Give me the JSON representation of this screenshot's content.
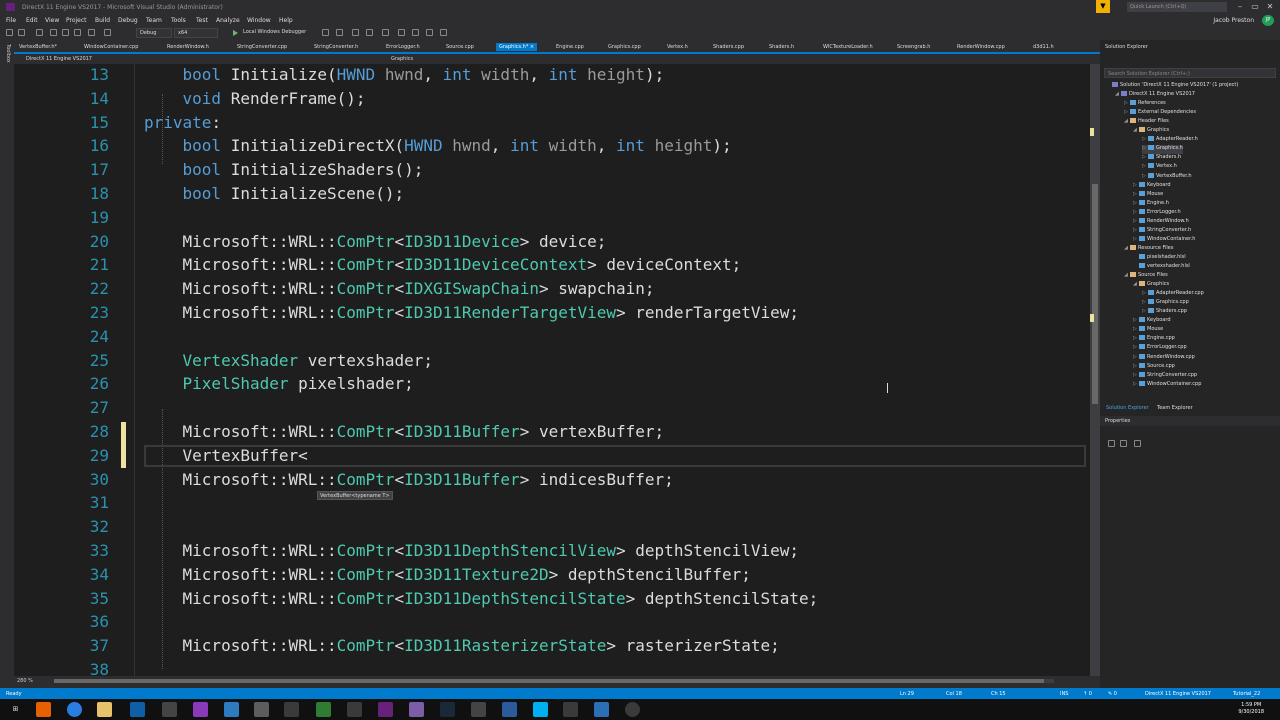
{
  "window": {
    "title": "DirectX 11 Engine VS2017 - Microsoft Visual Studio (Administrator)",
    "quick_launch": "Quick Launch (Ctrl+Q)",
    "user": "Jacob Preston",
    "user_initials": "JP"
  },
  "menu": [
    "File",
    "Edit",
    "View",
    "Project",
    "Build",
    "Debug",
    "Team",
    "Tools",
    "Test",
    "Analyze",
    "Window",
    "Help"
  ],
  "toolbar": {
    "config": "Debug",
    "platform": "x64",
    "debugger": "Local Windows Debugger"
  },
  "tabs": [
    {
      "label": "VertexBuffer.h*",
      "active": false
    },
    {
      "label": "WindowContainer.cpp",
      "active": false
    },
    {
      "label": "RenderWindow.h",
      "active": false
    },
    {
      "label": "StringConverter.cpp",
      "active": false
    },
    {
      "label": "StringConverter.h",
      "active": false
    },
    {
      "label": "ErrorLogger.h",
      "active": false
    },
    {
      "label": "Source.cpp",
      "active": false
    },
    {
      "label": "Graphics.h*  ×",
      "active": true
    },
    {
      "label": "Engine.cpp",
      "active": false
    },
    {
      "label": "Graphics.cpp",
      "active": false
    },
    {
      "label": "Vertex.h",
      "active": false
    },
    {
      "label": "Shaders.cpp",
      "active": false
    },
    {
      "label": "Shaders.h",
      "active": false
    },
    {
      "label": "WICTextureLoader.h",
      "active": false
    },
    {
      "label": "Screengrab.h",
      "active": false
    },
    {
      "label": "RenderWindow.cpp",
      "active": false
    },
    {
      "label": "d3d11.h",
      "active": false
    }
  ],
  "nav": {
    "project": "DirectX 11 Engine VS2017",
    "scope": "Graphics"
  },
  "left_strip": [
    "Toolbox"
  ],
  "editor": {
    "zoom": "280 %",
    "tooltip": "VertexBuffer<typename T>",
    "lines": [
      {
        "n": "13",
        "parts": [
          {
            "t": "    "
          },
          {
            "t": "bool",
            "c": "kw"
          },
          {
            "t": " Initialize("
          },
          {
            "t": "HWND",
            "c": "kw"
          },
          {
            "t": " hwnd",
            "c": "pm"
          },
          {
            "t": ", "
          },
          {
            "t": "int",
            "c": "kw"
          },
          {
            "t": " width",
            "c": "pm"
          },
          {
            "t": ", "
          },
          {
            "t": "int",
            "c": "kw"
          },
          {
            "t": " height",
            "c": "pm"
          },
          {
            "t": ");"
          }
        ]
      },
      {
        "n": "14",
        "parts": [
          {
            "t": "    "
          },
          {
            "t": "void",
            "c": "kw"
          },
          {
            "t": " RenderFrame();"
          }
        ]
      },
      {
        "n": "15",
        "parts": [
          {
            "t": "private",
            "c": "kw"
          },
          {
            "t": ":"
          }
        ]
      },
      {
        "n": "16",
        "parts": [
          {
            "t": "    "
          },
          {
            "t": "bool",
            "c": "kw"
          },
          {
            "t": " InitializeDirectX("
          },
          {
            "t": "HWND",
            "c": "kw"
          },
          {
            "t": " hwnd",
            "c": "pm"
          },
          {
            "t": ", "
          },
          {
            "t": "int",
            "c": "kw"
          },
          {
            "t": " width",
            "c": "pm"
          },
          {
            "t": ", "
          },
          {
            "t": "int",
            "c": "kw"
          },
          {
            "t": " height",
            "c": "pm"
          },
          {
            "t": ");"
          }
        ]
      },
      {
        "n": "17",
        "parts": [
          {
            "t": "    "
          },
          {
            "t": "bool",
            "c": "kw"
          },
          {
            "t": " InitializeShaders();"
          }
        ]
      },
      {
        "n": "18",
        "parts": [
          {
            "t": "    "
          },
          {
            "t": "bool",
            "c": "kw"
          },
          {
            "t": " InitializeScene();"
          }
        ]
      },
      {
        "n": "19",
        "parts": []
      },
      {
        "n": "20",
        "parts": [
          {
            "t": "    Microsoft::WRL::"
          },
          {
            "t": "ComPtr",
            "c": "ty"
          },
          {
            "t": "<"
          },
          {
            "t": "ID3D11Device",
            "c": "ty"
          },
          {
            "t": "> device;"
          }
        ]
      },
      {
        "n": "21",
        "parts": [
          {
            "t": "    Microsoft::WRL::"
          },
          {
            "t": "ComPtr",
            "c": "ty"
          },
          {
            "t": "<"
          },
          {
            "t": "ID3D11DeviceContext",
            "c": "ty"
          },
          {
            "t": "> deviceContext;"
          }
        ]
      },
      {
        "n": "22",
        "parts": [
          {
            "t": "    Microsoft::WRL::"
          },
          {
            "t": "ComPtr",
            "c": "ty"
          },
          {
            "t": "<"
          },
          {
            "t": "IDXGISwapChain",
            "c": "ty"
          },
          {
            "t": "> swapchain;"
          }
        ]
      },
      {
        "n": "23",
        "parts": [
          {
            "t": "    Microsoft::WRL::"
          },
          {
            "t": "ComPtr",
            "c": "ty"
          },
          {
            "t": "<"
          },
          {
            "t": "ID3D11RenderTargetView",
            "c": "ty"
          },
          {
            "t": "> renderTargetView;"
          }
        ]
      },
      {
        "n": "24",
        "parts": []
      },
      {
        "n": "25",
        "parts": [
          {
            "t": "    "
          },
          {
            "t": "VertexShader",
            "c": "ty"
          },
          {
            "t": " vertexshader;"
          }
        ]
      },
      {
        "n": "26",
        "parts": [
          {
            "t": "    "
          },
          {
            "t": "PixelShader",
            "c": "ty"
          },
          {
            "t": " pixelshader;"
          }
        ]
      },
      {
        "n": "27",
        "parts": []
      },
      {
        "n": "28",
        "parts": [
          {
            "t": "    Microsoft::WRL::"
          },
          {
            "t": "ComPtr",
            "c": "ty"
          },
          {
            "t": "<"
          },
          {
            "t": "ID3D11Buffer",
            "c": "ty"
          },
          {
            "t": "> vertexBuffer;"
          }
        ]
      },
      {
        "n": "29",
        "parts": [
          {
            "t": "    VertexBuffer<"
          }
        ]
      },
      {
        "n": "30",
        "parts": [
          {
            "t": "    Microsoft::WRL::"
          },
          {
            "t": "ComPtr",
            "c": "ty"
          },
          {
            "t": "<"
          },
          {
            "t": "ID3D11Buffer",
            "c": "ty"
          },
          {
            "t": "> indicesBuffer;"
          }
        ]
      },
      {
        "n": "31",
        "parts": []
      },
      {
        "n": "32",
        "parts": []
      },
      {
        "n": "33",
        "parts": [
          {
            "t": "    Microsoft::WRL::"
          },
          {
            "t": "ComPtr",
            "c": "ty"
          },
          {
            "t": "<"
          },
          {
            "t": "ID3D11DepthStencilView",
            "c": "ty"
          },
          {
            "t": "> depthStencilView;"
          }
        ]
      },
      {
        "n": "34",
        "parts": [
          {
            "t": "    Microsoft::WRL::"
          },
          {
            "t": "ComPtr",
            "c": "ty"
          },
          {
            "t": "<"
          },
          {
            "t": "ID3D11Texture2D",
            "c": "ty"
          },
          {
            "t": "> depthStencilBuffer;"
          }
        ]
      },
      {
        "n": "35",
        "parts": [
          {
            "t": "    Microsoft::WRL::"
          },
          {
            "t": "ComPtr",
            "c": "ty"
          },
          {
            "t": "<"
          },
          {
            "t": "ID3D11DepthStencilState",
            "c": "ty"
          },
          {
            "t": "> depthStencilState;"
          }
        ]
      },
      {
        "n": "36",
        "parts": []
      },
      {
        "n": "37",
        "parts": [
          {
            "t": "    Microsoft::WRL::"
          },
          {
            "t": "ComPtr",
            "c": "ty"
          },
          {
            "t": "<"
          },
          {
            "t": "ID3D11RasterizerState",
            "c": "ty"
          },
          {
            "t": "> rasterizerState;"
          }
        ]
      },
      {
        "n": "38",
        "parts": []
      }
    ]
  },
  "solution_explorer": {
    "title": "Solution Explorer",
    "search_placeholder": "Search Solution Explorer (Ctrl+;)",
    "items": [
      {
        "label": "Solution 'DirectX 11 Engine VS2017' (1 project)",
        "level": 0,
        "tri": ""
      },
      {
        "label": "DirectX 11 Engine VS2017",
        "level": 1,
        "tri": "◢"
      },
      {
        "label": "References",
        "level": 2,
        "tri": "▷"
      },
      {
        "label": "External Dependencies",
        "level": 2,
        "tri": "▷"
      },
      {
        "label": "Header Files",
        "level": 2,
        "tri": "◢"
      },
      {
        "label": "Graphics",
        "level": 3,
        "tri": "◢"
      },
      {
        "label": "AdapterReader.h",
        "level": 4,
        "tri": "▷"
      },
      {
        "label": "Graphics.h",
        "level": 4,
        "tri": "▷",
        "selected": true
      },
      {
        "label": "Shaders.h",
        "level": 4,
        "tri": "▷"
      },
      {
        "label": "Vertex.h",
        "level": 4,
        "tri": "▷"
      },
      {
        "label": "VertexBuffer.h",
        "level": 4,
        "tri": "▷"
      },
      {
        "label": "Keyboard",
        "level": 3,
        "tri": "▷"
      },
      {
        "label": "Mouse",
        "level": 3,
        "tri": "▷"
      },
      {
        "label": "Engine.h",
        "level": 3,
        "tri": "▷"
      },
      {
        "label": "ErrorLogger.h",
        "level": 3,
        "tri": "▷"
      },
      {
        "label": "RenderWindow.h",
        "level": 3,
        "tri": "▷"
      },
      {
        "label": "StringConverter.h",
        "level": 3,
        "tri": "▷"
      },
      {
        "label": "WindowContainer.h",
        "level": 3,
        "tri": "▷"
      },
      {
        "label": "Resource Files",
        "level": 2,
        "tri": "◢"
      },
      {
        "label": "pixelshader.hlsl",
        "level": 3,
        "tri": ""
      },
      {
        "label": "vertexshader.hlsl",
        "level": 3,
        "tri": ""
      },
      {
        "label": "Source Files",
        "level": 2,
        "tri": "◢"
      },
      {
        "label": "Graphics",
        "level": 3,
        "tri": "◢"
      },
      {
        "label": "AdapterReader.cpp",
        "level": 4,
        "tri": "▷"
      },
      {
        "label": "Graphics.cpp",
        "level": 4,
        "tri": "▷"
      },
      {
        "label": "Shaders.cpp",
        "level": 4,
        "tri": "▷"
      },
      {
        "label": "Keyboard",
        "level": 3,
        "tri": "▷"
      },
      {
        "label": "Mouse",
        "level": 3,
        "tri": "▷"
      },
      {
        "label": "Engine.cpp",
        "level": 3,
        "tri": "▷"
      },
      {
        "label": "ErrorLogger.cpp",
        "level": 3,
        "tri": "▷"
      },
      {
        "label": "RenderWindow.cpp",
        "level": 3,
        "tri": "▷"
      },
      {
        "label": "Source.cpp",
        "level": 3,
        "tri": "▷"
      },
      {
        "label": "StringConverter.cpp",
        "level": 3,
        "tri": "▷"
      },
      {
        "label": "WindowContainer.cpp",
        "level": 3,
        "tri": "▷"
      }
    ],
    "bottom_tabs": [
      "Solution Explorer",
      "Team Explorer"
    ],
    "properties_title": "Properties"
  },
  "status": {
    "ready": "Ready",
    "ln": "Ln 29",
    "col": "Col 18",
    "ch": "Ch 15",
    "ins": "INS",
    "up": "↑ 0",
    "edits": "✎ 0",
    "project": "DirectX 11 Engine VS2017",
    "branch": "Tutorial_22"
  },
  "clock": {
    "time": "1:59 PM",
    "date": "9/30/2018"
  },
  "colors": {
    "accent": "#007acc",
    "keyword": "#569cd6",
    "type": "#4ec9b0",
    "linenum": "#2b91af",
    "change_margin": "#efe1a0"
  }
}
